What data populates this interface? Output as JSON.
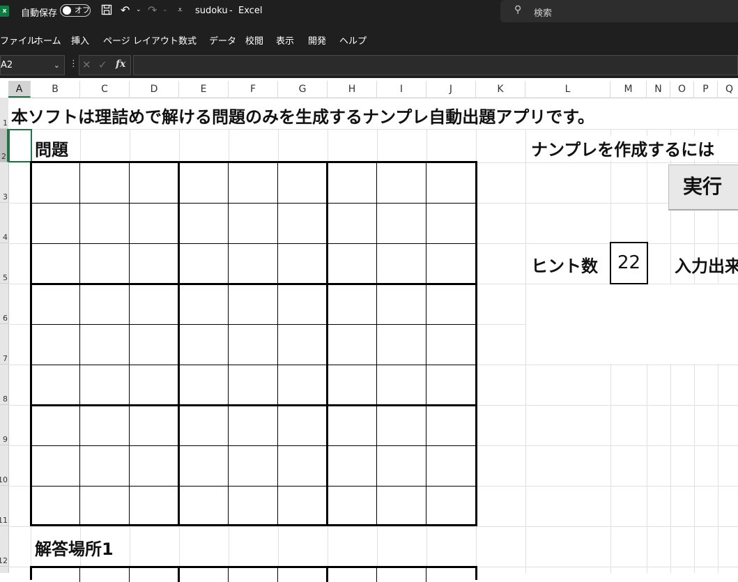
{
  "titlebar": {
    "app_icon_letter": "x",
    "autosave_label": "自動保存",
    "autosave_state": "オフ",
    "filename": "sudoku",
    "separator": "-",
    "app_name": "Excel",
    "search_placeholder": "検索"
  },
  "ribbon": {
    "tabs": [
      "ファイル",
      "ホーム",
      "挿入",
      "ページ レイアウト",
      "数式",
      "データ",
      "校閲",
      "表示",
      "開発",
      "ヘルプ"
    ]
  },
  "formula_bar": {
    "name_box": "A2",
    "fx_symbol": "fx",
    "formula": ""
  },
  "sheet": {
    "columns": [
      "A",
      "B",
      "C",
      "D",
      "E",
      "F",
      "G",
      "H",
      "I",
      "J",
      "K",
      "L",
      "M",
      "N",
      "O",
      "P",
      "Q"
    ],
    "selected_column": "A",
    "row_numbers": [
      "1",
      "2",
      "3",
      "4",
      "5",
      "6",
      "7",
      "8",
      "9",
      "10",
      "11",
      "12"
    ],
    "selected_row": "2",
    "intro_text": "本ソフトは理詰めで解ける問題のみを生成するナンプレ自動出題アプリです。",
    "puzzle_heading": "問題",
    "answer_heading": "解答場所1",
    "instruction_text": "ナンプレを作成するには",
    "run_button_label": "実行",
    "hint_label": "ヒント数",
    "hint_value": "22",
    "input_text": "入力出来"
  }
}
